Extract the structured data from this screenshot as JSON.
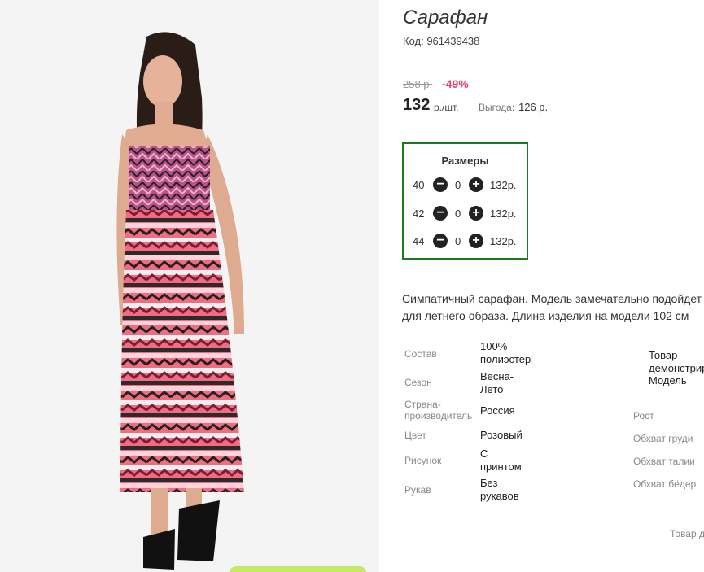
{
  "product": {
    "title": "Сарафан",
    "code": "Код: 961439438",
    "old_price": "258 р.",
    "discount": "-49%",
    "price": "132",
    "price_unit": "р./шт.",
    "benefit_label": "Выгода:",
    "benefit_value": "126 р."
  },
  "sizes": {
    "title": "Размеры",
    "rows": [
      {
        "size": "40",
        "qty": "0",
        "price": "132р."
      },
      {
        "size": "42",
        "qty": "0",
        "price": "132р."
      },
      {
        "size": "44",
        "qty": "0",
        "price": "132р."
      }
    ]
  },
  "description": "Симпатичный сарафан. Модель замечательно подойдет для летнего образа. Длина изделия на модели 102 см",
  "attributes": [
    {
      "label": "Состав",
      "value": "100% полиэстер"
    },
    {
      "label": "Сезон",
      "value": "Весна-Лето"
    },
    {
      "label": "Страна-производитель",
      "value": "Россия"
    },
    {
      "label": "Цвет",
      "value": "Розовый"
    },
    {
      "label": "Рисунок",
      "value": "С принтом"
    },
    {
      "label": "Рукав",
      "value": "Без рукавов"
    }
  ],
  "model": {
    "intro": "Товар демонстрирует Модель",
    "labels": [
      "Рост",
      "Обхват груди",
      "Обхват талии",
      "Обхват бёдер"
    ]
  },
  "footer_note": "Товар д",
  "icons": {
    "minus": "minus-circle-icon",
    "plus": "plus-circle-icon"
  },
  "colors": {
    "discount": "#e8466b",
    "sizes_border": "#1f7a1f",
    "accent_pill": "#c6e86a"
  }
}
